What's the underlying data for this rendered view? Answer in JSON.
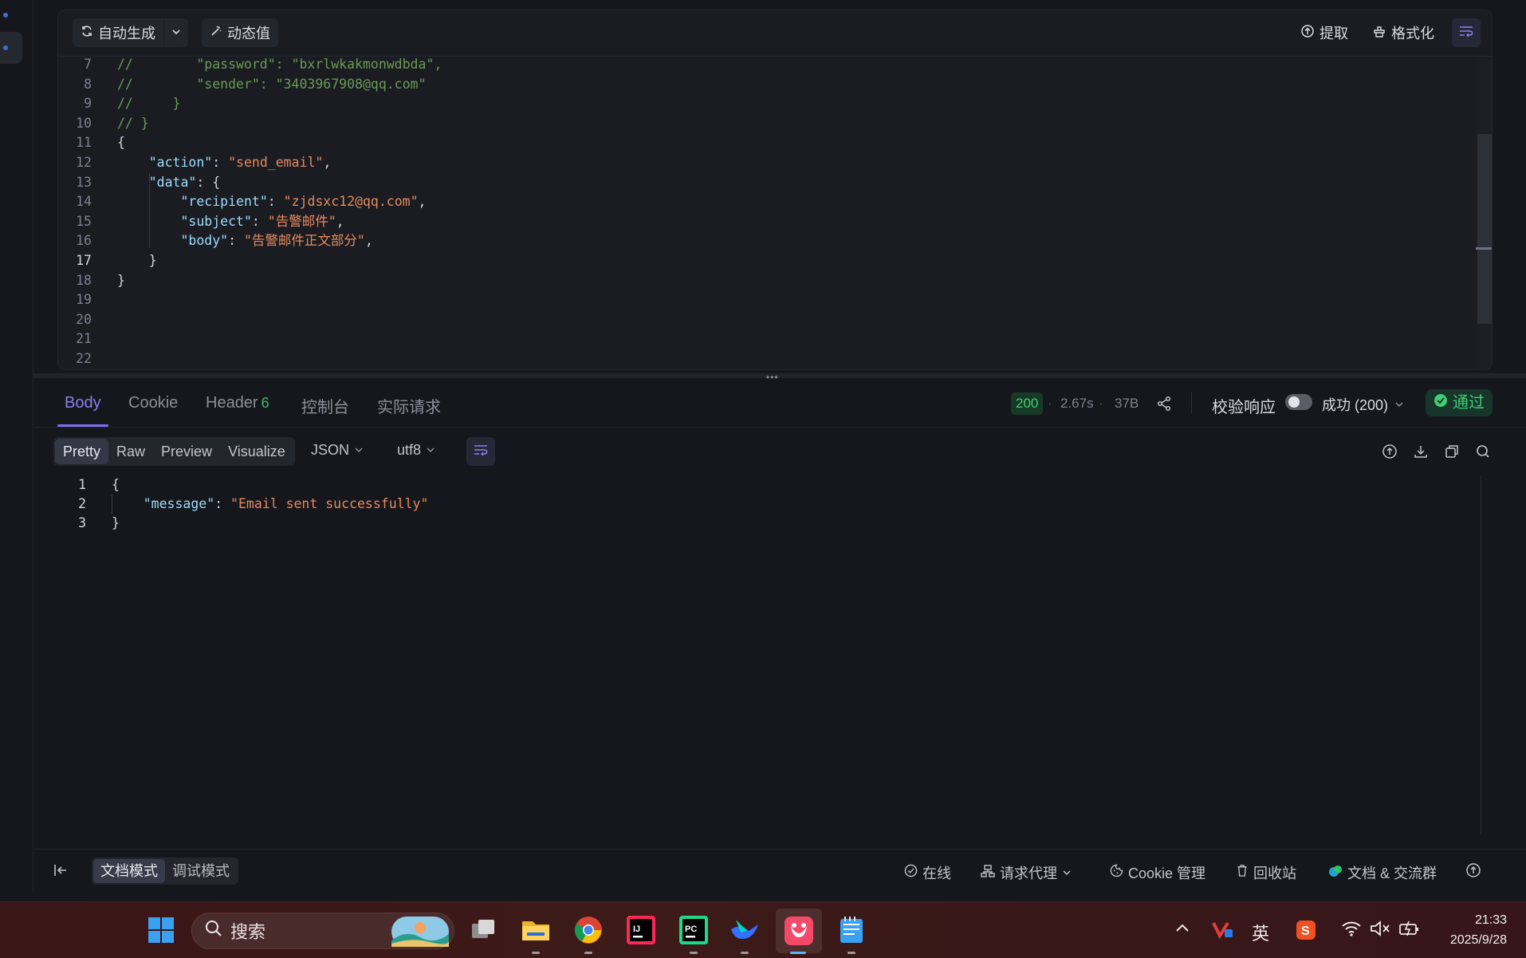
{
  "request_toolbar": {
    "auto_generate_label": "自动生成",
    "dynamic_value_label": "动态值",
    "extract_label": "提取",
    "format_label": "格式化"
  },
  "request_code": [
    {
      "ln": "7",
      "parts": [
        [
          "c-com",
          "//        \"password\": \"bxrlwkakmonwdbda\","
        ]
      ]
    },
    {
      "ln": "8",
      "parts": [
        [
          "c-com",
          "//        \"sender\": \"3403967908@qq.com\""
        ]
      ]
    },
    {
      "ln": "9",
      "parts": [
        [
          "c-com",
          "//     }"
        ]
      ]
    },
    {
      "ln": "10",
      "parts": [
        [
          "c-com",
          "// }"
        ]
      ]
    },
    {
      "ln": "11",
      "parts": [
        [
          "c-pun",
          "{"
        ]
      ]
    },
    {
      "ln": "12",
      "parts": [
        [
          "c-pun",
          "    "
        ],
        [
          "c-key",
          "\"action\""
        ],
        [
          "c-pun",
          ": "
        ],
        [
          "c-str",
          "\"send_email\""
        ],
        [
          "c-pun",
          ","
        ]
      ]
    },
    {
      "ln": "13",
      "parts": [
        [
          "c-pun",
          "    "
        ],
        [
          "c-key",
          "\"data\""
        ],
        [
          "c-pun",
          ": {"
        ]
      ]
    },
    {
      "ln": "14",
      "parts": [
        [
          "c-pun",
          "        "
        ],
        [
          "c-key",
          "\"recipient\""
        ],
        [
          "c-pun",
          ": "
        ],
        [
          "c-str",
          "\"zjdsxc12@qq.com\""
        ],
        [
          "c-pun",
          ","
        ]
      ]
    },
    {
      "ln": "15",
      "parts": [
        [
          "c-pun",
          "        "
        ],
        [
          "c-key",
          "\"subject\""
        ],
        [
          "c-pun",
          ": "
        ],
        [
          "c-str",
          "\"告警邮件\""
        ],
        [
          "c-pun",
          ","
        ]
      ]
    },
    {
      "ln": "16",
      "parts": [
        [
          "c-pun",
          "        "
        ],
        [
          "c-key",
          "\"body\""
        ],
        [
          "c-pun",
          ": "
        ],
        [
          "c-str",
          "\"告警邮件正文部分\""
        ],
        [
          "c-pun",
          ","
        ]
      ]
    },
    {
      "ln": "17",
      "active": true,
      "parts": [
        [
          "c-pun",
          "    }"
        ]
      ]
    },
    {
      "ln": "18",
      "parts": [
        [
          "c-pun",
          "}"
        ]
      ]
    },
    {
      "ln": "19",
      "parts": []
    },
    {
      "ln": "20",
      "parts": []
    },
    {
      "ln": "21",
      "parts": []
    },
    {
      "ln": "22",
      "parts": []
    }
  ],
  "response_tabs": {
    "body": "Body",
    "cookie": "Cookie",
    "header": "Header",
    "header_count": "6",
    "console": "控制台",
    "actual_request": "实际请求"
  },
  "response_meta": {
    "status_code": "200",
    "time": "2.67s",
    "size": "37B",
    "validate_label": "校验响应",
    "validate_result": "成功 (200)",
    "pass_label": "通过"
  },
  "format_bar": {
    "modes": [
      "Pretty",
      "Raw",
      "Preview",
      "Visualize"
    ],
    "active_mode": "Pretty",
    "format_select": "JSON",
    "encoding_select": "utf8"
  },
  "response_code": [
    {
      "ln": "1",
      "parts": [
        [
          "c-pun",
          "{"
        ]
      ]
    },
    {
      "ln": "2",
      "parts": [
        [
          "c-pun",
          "    "
        ],
        [
          "c-key",
          "\"message\""
        ],
        [
          "c-pun",
          ": "
        ],
        [
          "c-str",
          "\"Email sent successfully\""
        ]
      ]
    },
    {
      "ln": "3",
      "parts": [
        [
          "c-pun",
          "}"
        ]
      ]
    }
  ],
  "status_bar": {
    "doc_mode": "文档模式",
    "debug_mode": "调试模式",
    "online": "在线",
    "proxy": "请求代理",
    "cookie_manager": "Cookie 管理",
    "recycle_bin": "回收站",
    "docs_group": "文档 & 交流群"
  },
  "taskbar": {
    "search_placeholder": "搜索",
    "ime_label": "英",
    "time": "21:33",
    "date": "2025/9/28"
  },
  "colors": {
    "accent": "#8b7ef0",
    "success": "#3fcf74",
    "json_key": "#9cdcfe",
    "json_string": "#e58a5e",
    "comment": "#6a9a55"
  }
}
